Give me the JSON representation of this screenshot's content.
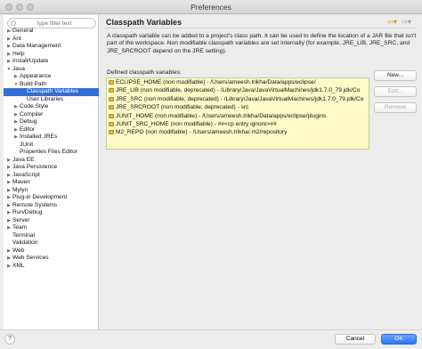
{
  "window": {
    "title": "Preferences"
  },
  "filter": {
    "placeholder": "type filter text"
  },
  "tree": [
    {
      "label": "General",
      "level": 0,
      "arrow": "right"
    },
    {
      "label": "Ant",
      "level": 0,
      "arrow": "right"
    },
    {
      "label": "Data Management",
      "level": 0,
      "arrow": "right"
    },
    {
      "label": "Help",
      "level": 0,
      "arrow": "right"
    },
    {
      "label": "Install/Update",
      "level": 0,
      "arrow": "right"
    },
    {
      "label": "Java",
      "level": 0,
      "arrow": "down"
    },
    {
      "label": "Appearance",
      "level": 1,
      "arrow": "right"
    },
    {
      "label": "Build Path",
      "level": 1,
      "arrow": "down"
    },
    {
      "label": "Classpath Variables",
      "level": 2,
      "arrow": "",
      "selected": true
    },
    {
      "label": "User Libraries",
      "level": 2,
      "arrow": ""
    },
    {
      "label": "Code Style",
      "level": 1,
      "arrow": "right"
    },
    {
      "label": "Compiler",
      "level": 1,
      "arrow": "right"
    },
    {
      "label": "Debug",
      "level": 1,
      "arrow": "right"
    },
    {
      "label": "Editor",
      "level": 1,
      "arrow": "right"
    },
    {
      "label": "Installed JREs",
      "level": 1,
      "arrow": "right"
    },
    {
      "label": "JUnit",
      "level": 1,
      "arrow": ""
    },
    {
      "label": "Properties Files Editor",
      "level": 1,
      "arrow": ""
    },
    {
      "label": "Java EE",
      "level": 0,
      "arrow": "right"
    },
    {
      "label": "Java Persistence",
      "level": 0,
      "arrow": "right"
    },
    {
      "label": "JavaScript",
      "level": 0,
      "arrow": "right"
    },
    {
      "label": "Maven",
      "level": 0,
      "arrow": "right"
    },
    {
      "label": "Mylyn",
      "level": 0,
      "arrow": "right"
    },
    {
      "label": "Plug-in Development",
      "level": 0,
      "arrow": "right"
    },
    {
      "label": "Remote Systems",
      "level": 0,
      "arrow": "right"
    },
    {
      "label": "Run/Debug",
      "level": 0,
      "arrow": "right"
    },
    {
      "label": "Server",
      "level": 0,
      "arrow": "right"
    },
    {
      "label": "Team",
      "level": 0,
      "arrow": "right"
    },
    {
      "label": "Terminal",
      "level": 0,
      "arrow": ""
    },
    {
      "label": "Validation",
      "level": 0,
      "arrow": ""
    },
    {
      "label": "Web",
      "level": 0,
      "arrow": "right"
    },
    {
      "label": "Web Services",
      "level": 0,
      "arrow": "right"
    },
    {
      "label": "XML",
      "level": 0,
      "arrow": "right"
    }
  ],
  "page": {
    "title": "Classpath Variables",
    "description": "A classpath variable can be added to a project's class path. It can be used to define the location of a JAR file that isn't part of the workspace. Non modifiable classpath variables are set internally (for example, JRE_LIB, JRE_SRC, and JRE_SRCROOT depend on the JRE setting).",
    "defined_label": "Defined classpath variables:",
    "variables": [
      "ECLIPSE_HOME (non modifiable) - /Users/ameesh.trikha/Data/apps/eclipse/",
      "JRE_LIB (non modifiable, deprecated) - /Library/Java/JavaVirtualMachines/jdk1.7.0_79.jdk/Co",
      "JRE_SRC (non modifiable, deprecated) - /Library/Java/JavaVirtualMachines/jdk1.7.0_79.jdk/Co",
      "JRE_SRCROOT (non modifiable, deprecated) - src",
      "JUNIT_HOME (non modifiable) - /Users/ameesh.trikha/Data/apps/eclipse/plugins",
      "JUNIT_SRC_HOME (non modifiable) - ##<cp entry ignore>##",
      "M2_REPO (non modifiable) - /Users/ameesh.trikha/.m2/repository"
    ],
    "buttons": {
      "new": "New...",
      "edit": "Edit...",
      "remove": "Remove"
    }
  },
  "footer": {
    "help": "?",
    "cancel": "Cancel",
    "ok": "OK"
  },
  "colors": {
    "selection": "#2f6fd6",
    "list_background": "#fffac8",
    "ok_button": "#2f73f0",
    "nav_arrow": "#d88a1a"
  }
}
